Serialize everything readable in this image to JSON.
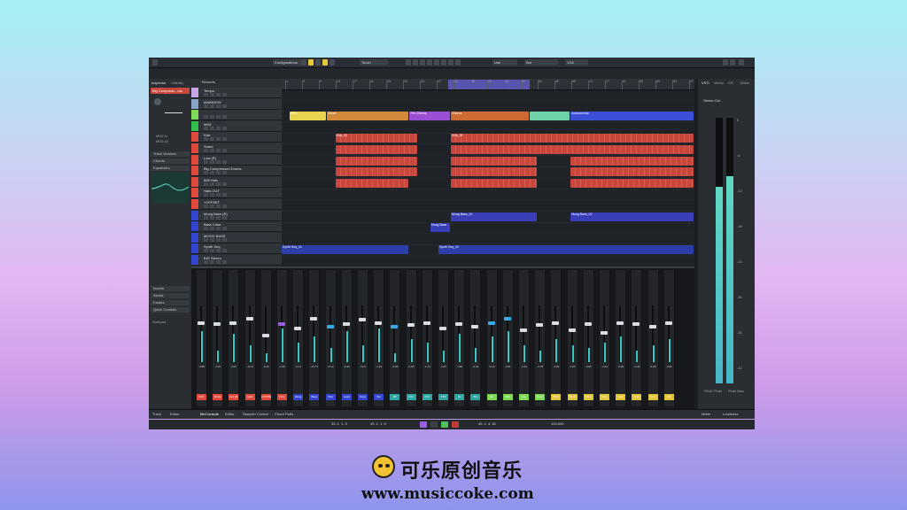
{
  "app": {
    "toolbar": {
      "configurations_label": "Configurations",
      "touch_label": "Touch",
      "grid_label": "Bar",
      "quantize_label": "1/16",
      "zoom_label": "Use"
    },
    "inspector": {
      "tabs": [
        "Inspector",
        "Visibility"
      ],
      "track_name": "Big Compress...ms",
      "sections": [
        "Track Versions",
        "Chords",
        "Equalizers",
        "Inserts",
        "Sends",
        "Faders",
        "Quick Controls"
      ],
      "routing": [
        "MIDI In",
        "MIDI All"
      ],
      "notepad_label": "Notepad"
    },
    "tracklist": {
      "header": "Records",
      "tracks": [
        {
          "name": "Tempo",
          "color": "#c7a6e6"
        },
        {
          "name": "MARKERS",
          "color": "#8aa2c9"
        },
        {
          "name": "",
          "color": "#7ed957"
        },
        {
          "name": "MIDI",
          "color": "#2fbf4a"
        },
        {
          "name": "Kick",
          "color": "#e04a3c"
        },
        {
          "name": "Snare",
          "color": "#e04a3c"
        },
        {
          "name": "Low (R)",
          "color": "#e04a3c"
        },
        {
          "name": "Big Compressed Drums",
          "color": "#e04a3c"
        },
        {
          "name": "808 Hats",
          "color": "#e04a3c"
        },
        {
          "name": "Hats OUT",
          "color": "#e04a3c"
        },
        {
          "name": "+OFFSET",
          "color": "#e04a3c"
        },
        {
          "name": "Moog Bass (R)",
          "color": "#3446cf"
        },
        {
          "name": "Bass Coke",
          "color": "#3446cf"
        },
        {
          "name": "MOOG BASS",
          "color": "#3446cf"
        },
        {
          "name": "Synth Seq",
          "color": "#3446cf"
        },
        {
          "name": "BIG Stereo",
          "color": "#3446cf"
        }
      ]
    },
    "arrange": {
      "ruler_numbers": [
        "1",
        "5",
        "9",
        "13",
        "17",
        "21",
        "25",
        "29",
        "33",
        "37",
        "41",
        "45",
        "49",
        "53",
        "57",
        "61",
        "65",
        "69",
        "73",
        "77",
        "81",
        "85",
        "89",
        "93",
        "97"
      ],
      "clips": [
        {
          "lane": 2,
          "label": "Intro",
          "start": 0.02,
          "end": 0.11,
          "color": "#e8d44d"
        },
        {
          "lane": 2,
          "label": "Verse",
          "start": 0.11,
          "end": 0.31,
          "color": "#d18a3a"
        },
        {
          "lane": 2,
          "label": "Pre-Chorus",
          "start": 0.31,
          "end": 0.41,
          "color": "#9b4fd6"
        },
        {
          "lane": 2,
          "label": "Chorus",
          "start": 0.41,
          "end": 0.6,
          "color": "#cf6a35"
        },
        {
          "lane": 2,
          "label": "",
          "start": 0.6,
          "end": 0.7,
          "color": "#6fd1a8"
        },
        {
          "lane": 2,
          "label": "Instrumental",
          "start": 0.7,
          "end": 1.0,
          "color": "#3c4fd8"
        },
        {
          "lane": 4,
          "label": "Kick_01",
          "start": 0.13,
          "end": 0.33,
          "color": "red"
        },
        {
          "lane": 4,
          "label": "Kick_02",
          "start": 0.41,
          "end": 1.0,
          "color": "red"
        },
        {
          "lane": 5,
          "label": "",
          "start": 0.13,
          "end": 0.33,
          "color": "red"
        },
        {
          "lane": 5,
          "label": "",
          "start": 0.41,
          "end": 1.0,
          "color": "red"
        },
        {
          "lane": 6,
          "label": "",
          "start": 0.13,
          "end": 0.33,
          "color": "red"
        },
        {
          "lane": 6,
          "label": "",
          "start": 0.41,
          "end": 0.62,
          "color": "red"
        },
        {
          "lane": 6,
          "label": "",
          "start": 0.7,
          "end": 1.0,
          "color": "red"
        },
        {
          "lane": 7,
          "label": "",
          "start": 0.13,
          "end": 0.33,
          "color": "red"
        },
        {
          "lane": 7,
          "label": "",
          "start": 0.41,
          "end": 0.62,
          "color": "red"
        },
        {
          "lane": 7,
          "label": "",
          "start": 0.7,
          "end": 1.0,
          "color": "red"
        },
        {
          "lane": 8,
          "label": "",
          "start": 0.13,
          "end": 0.31,
          "color": "red"
        },
        {
          "lane": 8,
          "label": "",
          "start": 0.41,
          "end": 0.62,
          "color": "red"
        },
        {
          "lane": 8,
          "label": "",
          "start": 0.7,
          "end": 1.0,
          "color": "red"
        },
        {
          "lane": 11,
          "label": "Moog Bass_01",
          "start": 0.41,
          "end": 0.62,
          "color": "blue"
        },
        {
          "lane": 11,
          "label": "Moog Bass_02",
          "start": 0.7,
          "end": 1.0,
          "color": "blue"
        },
        {
          "lane": 12,
          "label": "Moog Bass",
          "start": 0.36,
          "end": 0.41,
          "color": "blue"
        },
        {
          "lane": 14,
          "label": "Synth Seq_01",
          "start": 0.0,
          "end": 0.31,
          "color": "bluebar"
        },
        {
          "lane": 14,
          "label": "Synth Seq_02",
          "start": 0.38,
          "end": 1.0,
          "color": "bluebar"
        }
      ]
    },
    "mixer": {
      "channels": [
        {
          "name": "Kick",
          "val": "-3.89",
          "color": "#e04a3c",
          "fader": 0.72,
          "meter": 0.55,
          "knob": "white"
        },
        {
          "name": "Snare",
          "val": "-1.53",
          "color": "#e04a3c",
          "fader": 0.7,
          "meter": 0.2,
          "knob": "white"
        },
        {
          "name": "Low (R)",
          "val": "0.00",
          "color": "#e04a3c",
          "fader": 0.72,
          "meter": 0.5,
          "knob": "white"
        },
        {
          "name": "Hats",
          "val": "-12.6",
          "color": "#e04a3c",
          "fader": 0.8,
          "meter": 0.3,
          "knob": "white"
        },
        {
          "name": "+OFFSET",
          "val": "-4.42",
          "color": "#e04a3c",
          "fader": 0.5,
          "meter": 0.15,
          "knob": "white"
        },
        {
          "name": "Perc",
          "val": "-2.36",
          "color": "#e04a3c",
          "fader": 0.7,
          "meter": 0.6,
          "knob": "purple"
        },
        {
          "name": "Moog",
          "val": "-1.11",
          "color": "#3446cf",
          "fader": 0.62,
          "meter": 0.35,
          "knob": "white"
        },
        {
          "name": "Bass",
          "val": "-14.77",
          "color": "#3446cf",
          "fader": 0.8,
          "meter": 0.45,
          "knob": "white"
        },
        {
          "name": "Pad",
          "val": "-0.12",
          "color": "#3446cf",
          "fader": 0.66,
          "meter": 0.25,
          "knob": "blue"
        },
        {
          "name": "Lead",
          "val": "-4.30",
          "color": "#3446cf",
          "fader": 0.7,
          "meter": 0.55,
          "knob": "white"
        },
        {
          "name": "Keys",
          "val": "-12.5",
          "color": "#3446cf",
          "fader": 0.78,
          "meter": 0.3,
          "knob": "white"
        },
        {
          "name": "Vox",
          "val": "-1.31",
          "color": "#3446cf",
          "fader": 0.72,
          "meter": 0.6,
          "knob": "white"
        },
        {
          "name": "BV",
          "val": "-0.05",
          "color": "#2fa6a6",
          "fader": 0.65,
          "meter": 0.15,
          "knob": "blue"
        },
        {
          "name": "FX1",
          "val": "-4.68",
          "color": "#2fa6a6",
          "fader": 0.68,
          "meter": 0.4,
          "knob": "white"
        },
        {
          "name": "FX2",
          "val": "-1.14",
          "color": "#2fa6a6",
          "fader": 0.72,
          "meter": 0.35,
          "knob": "white"
        },
        {
          "name": "FX3",
          "val": "-1.87",
          "color": "#2fa6a6",
          "fader": 0.62,
          "meter": 0.2,
          "knob": "white"
        },
        {
          "name": "Str",
          "val": "-1.80",
          "color": "#2fa6a6",
          "fader": 0.7,
          "meter": 0.5,
          "knob": "white"
        },
        {
          "name": "Brs",
          "val": "-2.63",
          "color": "#2fa6a6",
          "fader": 0.66,
          "meter": 0.25,
          "knob": "white"
        },
        {
          "name": "Gtr",
          "val": "-3.12",
          "color": "#7ed957",
          "fader": 0.72,
          "meter": 0.45,
          "knob": "blue"
        },
        {
          "name": "Rev",
          "val": "-2.81",
          "color": "#7ed957",
          "fader": 0.8,
          "meter": 0.55,
          "knob": "blue"
        },
        {
          "name": "Dly",
          "val": "-1.64",
          "color": "#7ed957",
          "fader": 0.6,
          "meter": 0.3,
          "knob": "white"
        },
        {
          "name": "Bus1",
          "val": "-2.78",
          "color": "#7ed957",
          "fader": 0.68,
          "meter": 0.2,
          "knob": "white"
        },
        {
          "name": "Bus2",
          "val": "-4.82",
          "color": "#e3c53a",
          "fader": 0.72,
          "meter": 0.4,
          "knob": "white"
        },
        {
          "name": "Bus3",
          "val": "-1.82",
          "color": "#e3c53a",
          "fader": 0.6,
          "meter": 0.3,
          "knob": "white"
        },
        {
          "name": "Bus4",
          "val": "-3.05",
          "color": "#e3c53a",
          "fader": 0.7,
          "meter": 0.25,
          "knob": "white"
        },
        {
          "name": "Grp1",
          "val": "-4.41",
          "color": "#e3c53a",
          "fader": 0.55,
          "meter": 0.35,
          "knob": "white"
        },
        {
          "name": "Grp2",
          "val": "-2.90",
          "color": "#e3c53a",
          "fader": 0.72,
          "meter": 0.45,
          "knob": "white"
        },
        {
          "name": "Grp3",
          "val": "-2.26",
          "color": "#e3c53a",
          "fader": 0.7,
          "meter": 0.2,
          "knob": "white"
        },
        {
          "name": "Grp4",
          "val": "-6.05",
          "color": "#e3c53a",
          "fader": 0.66,
          "meter": 0.3,
          "knob": "white"
        },
        {
          "name": "Out",
          "val": "-0.52",
          "color": "#e3c53a",
          "fader": 0.72,
          "meter": 0.4,
          "knob": "white"
        }
      ]
    },
    "right_zone": {
      "tabs": [
        "VSTi",
        "Media",
        "CR",
        "Meter"
      ],
      "master_label": "Stereo Out",
      "meter_left_level": 0.74,
      "meter_right_level": 0.78,
      "scale": [
        "0",
        "-6",
        "-12",
        "-18",
        "-24",
        "-30",
        "-36",
        "-42"
      ],
      "readouts": [
        "TRUE Peak",
        "Peak Max"
      ]
    },
    "bottom_tabs": [
      "Track",
      "Editor",
      "MixConsole",
      "Editor",
      "Sampler Control",
      "Chord Pads"
    ],
    "right_bottom_tabs": [
      "Meter",
      "Loudness"
    ],
    "transport": {
      "left_locator": "33. 1. 1. 0",
      "right_locator": "49. 1. 1. 0",
      "position": "45. 1. 4. 81",
      "tempo": "124.000"
    }
  },
  "brand": {
    "name": "可乐原创音乐",
    "url": "www.musiccoke.com"
  }
}
